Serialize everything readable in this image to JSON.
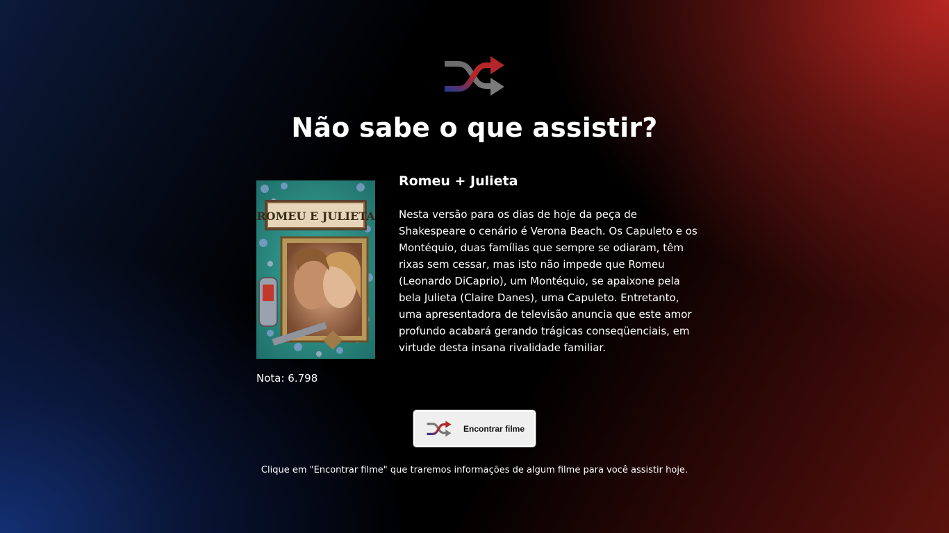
{
  "header": {
    "icon": "shuffle-icon",
    "title": "Não sabe o que assistir?"
  },
  "movie": {
    "poster_title_text": "ROMEU E JULIETA",
    "poster_icon": "movie-poster",
    "title": "Romeu + Julieta",
    "overview": "Nesta versão para os dias de hoje da peça de Shakespeare o cenário é Verona Beach. Os Capuleto e os Montéquio, duas famílias que sempre se odiaram, têm rixas sem cessar, mas isto não impede que Romeu (Leonardo DiCaprio), um Montéquio, se apaixone pela bela Julieta (Claire Danes), uma Capuleto. Entretanto, uma apresentadora de televisão anuncia que este amor profundo acabará gerando trágicas conseqüenciais, em virtude desta insana rivalidade familiar.",
    "rating_text": "Nota: 6.798"
  },
  "action": {
    "button_label": "Encontrar filme",
    "button_icon": "shuffle-icon"
  },
  "footer": {
    "hint": "Clique em \"Encontrar filme\" que traremos informações de algum filme para você assistir hoje."
  },
  "colors": {
    "accent_red": "#b3262a",
    "accent_blue": "#2a3a8c",
    "text": "#ffffff"
  }
}
